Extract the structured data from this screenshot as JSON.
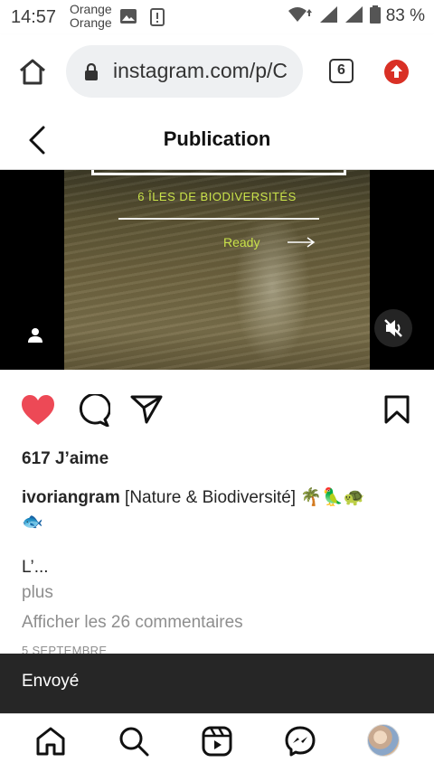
{
  "status_bar": {
    "time": "14:57",
    "carrier_line1": "Orange",
    "carrier_line2": "Orange",
    "battery": "83 %"
  },
  "browser": {
    "url": "instagram.com/p/C",
    "tab_count": "6"
  },
  "header": {
    "title": "Publication"
  },
  "video": {
    "caption": "6 ÎLES DE BIODIVERSITÉS",
    "ready_label": "Ready"
  },
  "post": {
    "likes": "617 J’aime",
    "username": "ivoriangram",
    "caption": "[Nature & Biodiversité] 🌴🦜🐢",
    "caption_cont": "🐟",
    "caption_truncated": "L’...",
    "more": "plus",
    "view_comments": "Afficher les 26 commentaires",
    "date": "5 SEPTEMBRE"
  },
  "toast": {
    "message": "Envoyé"
  },
  "colors": {
    "like_red": "#ed4956",
    "caption_yellow": "#c9e24a",
    "toast_bg": "#262626"
  },
  "icons": [
    "home-icon",
    "search-icon",
    "reels-icon",
    "messenger-icon",
    "heart-icon",
    "comment-icon",
    "share-icon",
    "bookmark-icon",
    "mute-icon",
    "user-tag-icon"
  ]
}
